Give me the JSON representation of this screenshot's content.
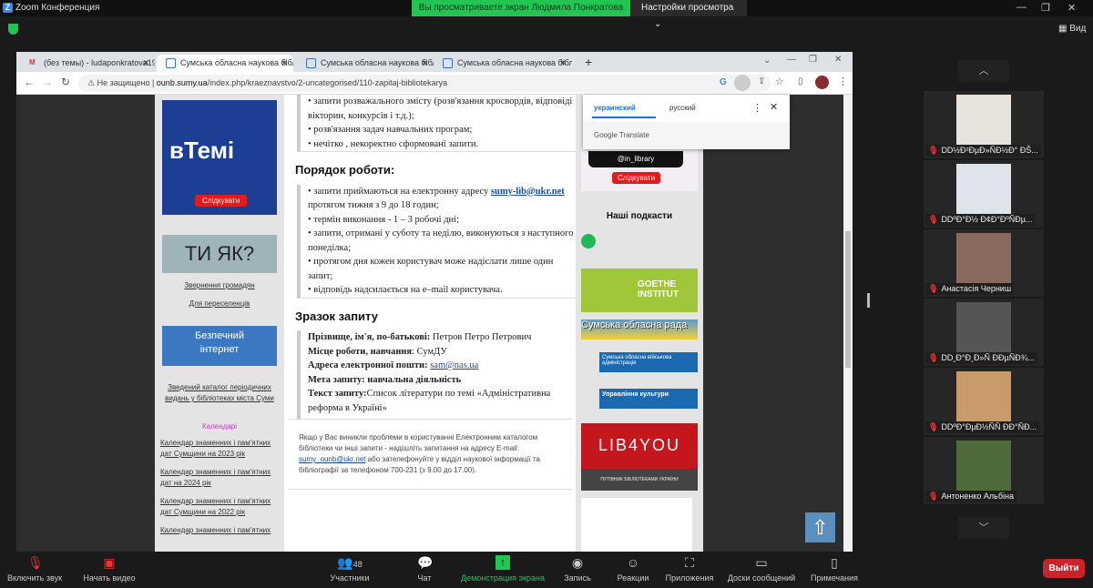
{
  "zoom": {
    "window_title": "Zoom Конференция",
    "banner": "Вы просматриваете экран Людмила Понкратова",
    "view_options": "Настройки просмотра",
    "view_button": "Вид",
    "participants": [
      {
        "name": "DD½Ð²ÐµÐ»ÑÐ½Ð° ÐŠ..."
      },
      {
        "name": "DDºÐ°Ð½ Ð¢Ð°ÐºÑÐµ..."
      },
      {
        "name": "Анастасія Черниш"
      },
      {
        "name": "DD¸Ð°Ð¸Ð»Ñ ÐÐµÑÐ¾..."
      },
      {
        "name": "DDºÐ°ÐµÐ½ÑÑ ÐÐ°ÑÐ..."
      },
      {
        "name": "Антоненко Альбіна"
      }
    ],
    "toolbar": {
      "audio": "Включить звук",
      "video": "Начать видео",
      "participants": "Участники",
      "participants_count": "48",
      "chat": "Чат",
      "share": "Демонстрация экрана",
      "record": "Запись",
      "reactions": "Реакции",
      "apps": "Приложения",
      "whiteboards": "Доски сообщений",
      "notes": "Примечания",
      "leave": "Выйти"
    }
  },
  "browser": {
    "tabs": [
      {
        "label": "(без темы) - ludaponkratova19..."
      },
      {
        "label": "Сумська обласна наукова бібл..."
      },
      {
        "label": "Сумська обласна наукова бібл..."
      },
      {
        "label": "Сумська обласна наукова бібл..."
      }
    ],
    "not_secure": "Не защищено",
    "url_domain": "ounb.sumy.ua",
    "url_path": "/index.php/kraeznavstvo/2-uncategorised/110-zapitaj-bibliotekarya"
  },
  "translate": {
    "lang1": "украинский",
    "lang2": "русский",
    "brand": "Google Translate"
  },
  "left_sidebar": {
    "banner1": "вТемі",
    "banner1_btn": "Слідкувати",
    "banner2": "ТИ ЯК?",
    "link1": "Звернення громадян",
    "link2": "Для переселенців",
    "banner3_l1": "Безпечний",
    "banner3_l2": "інтернет",
    "catalog_link": "Зведений каталог періодичних видань у бібліотеках міста Суми",
    "calendars_title": "Календарі",
    "calendars": [
      "Календар знаменних і пам'ятних дат Сумщини на 2023 рік",
      "Календар знаменних і пам'ятних дат на 2024 рік",
      "Календар знаменних і пам'ятних дат Сумщини на 2022 рік",
      "Календар знаменних і пам'ятних"
    ]
  },
  "main": {
    "list1": [
      "• запити розважального змісту (розв'язання кросвордів, відповіді вікторин, конкурсів і т.д.);",
      "• розв'язання задач навчальних програм;",
      "• нечітко , некоректно сформовані запити."
    ],
    "h_order": "Порядок роботи:",
    "order_1a": "• запити приймаються на електронну адресу ",
    "order_email": "sumy-lib@ukr.net",
    "order_1b": " протягом тижня з 9 до 18 годин;",
    "order": [
      "• термін виконання - 1 – 3 робочі дні;",
      "• запити, отримані у суботу та неділю, виконуються з наступного понеділка;",
      "• протягом дня кожен користувач може надіслати лише один запит;",
      "• відповідь надсилається на e–mail користувача."
    ],
    "h_sample": "Зразок запиту",
    "s1k": "Прізвище, ім'я, по-батькові:",
    "s1v": " Петров Петро Петрович",
    "s2k": "Місце роботи, навчання",
    "s2v": ": СумДУ",
    "s3k": "Адреса електронної пошти: ",
    "s3v": "sam@nas.ua",
    "s4": "Мета запиту: навчальна діяльність",
    "s5k": "Текст запиту:",
    "s5v": "Список літератури по темі «Адміністративна реформа в Україні»",
    "foot_a": "Якщо у Вас виникли проблеми в користуванні Електронним каталогом бібліотеки чи інші запити - надішліть запитання на адресу E-mail: ",
    "foot_email": "sumy_ounb@ukr.net",
    "foot_b": " або зателефонуйте у відділ наукової інформації та бібліографії за телефоном 700-231 (з 9.00 до 17.00)."
  },
  "right_sidebar": {
    "tiktok_handle": "@in_library",
    "tiktok_btn": "Слідкувати",
    "podcasts": "Наші подкасти",
    "goethe": "GOETHE INSTITUT",
    "rada": "Сумська обласна рада",
    "admin": "Сумська обласна військова адміністрація",
    "culture": "Управління культури",
    "lib4you": "LIB4YOU",
    "lib4you_sub": "ПУТІВНИК БІБЛІОТЕКАМИ УКРАЇНИ"
  }
}
